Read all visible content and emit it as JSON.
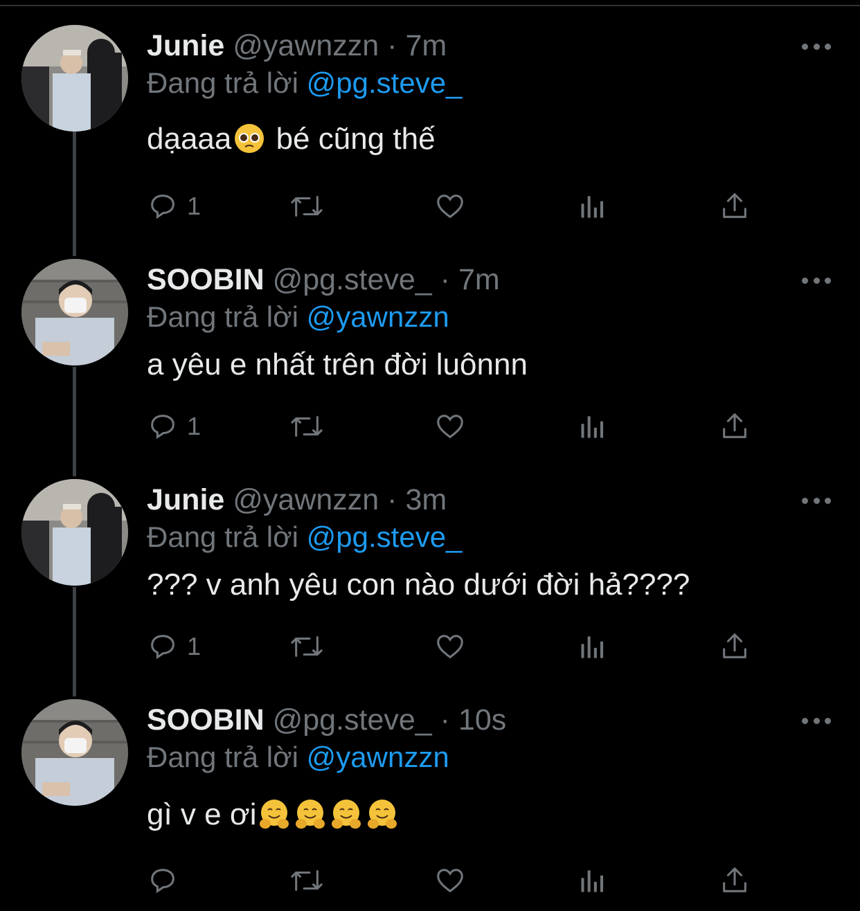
{
  "tweets": [
    {
      "name": "Junie",
      "handle": "@yawnzzn",
      "dot": "·",
      "time": "7m",
      "reply_prefix": "Đang trả lời",
      "reply_to": "@pg.steve_",
      "text_main": "dạaaa",
      "text_emoji": "pleading-face",
      "text_rest": " bé cũng thế",
      "reply_count": "1"
    },
    {
      "name": "SOOBIN",
      "handle": "@pg.steve_",
      "dot": "·",
      "time": "7m",
      "reply_prefix": "Đang trả lời",
      "reply_to": "@yawnzzn",
      "text": "a yêu e nhất trên đời luônnn",
      "reply_count": "1"
    },
    {
      "name": "Junie",
      "handle": "@yawnzzn",
      "dot": "·",
      "time": "3m",
      "reply_prefix": "Đang trả lời",
      "reply_to": "@pg.steve_",
      "text": "??? v anh yêu con nào dưới đời hả????",
      "reply_count": "1"
    },
    {
      "name": "SOOBIN",
      "handle": "@pg.steve_",
      "dot": "·",
      "time": "10s",
      "reply_prefix": "Đang trả lời",
      "reply_to": "@yawnzzn",
      "text": "gì v e ơi",
      "text_emoji": "hugging-face",
      "reply_count": ""
    }
  ],
  "icons": {
    "reply": "reply-icon",
    "retweet": "retweet-icon",
    "like": "heart-icon",
    "views": "views-chart-icon",
    "share": "share-icon",
    "more": "more-icon"
  },
  "colors": {
    "background": "#000000",
    "primary_text": "#e7e9ea",
    "secondary_text": "#71767b",
    "accent": "#1d9bf0",
    "thread_line": "#3d4146"
  }
}
